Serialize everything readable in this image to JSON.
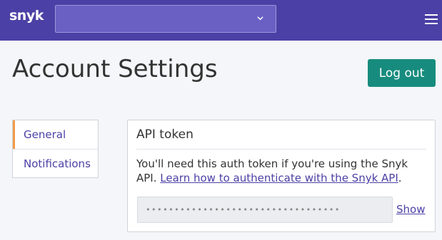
{
  "header": {
    "logo_text": "snyk",
    "org_select_value": "",
    "menu_icon": "hamburger-icon",
    "brand_color": "#4b40a5"
  },
  "page": {
    "title": "Account Settings",
    "logout_label": "Log out"
  },
  "sidebar": {
    "items": [
      {
        "label": "General",
        "active": true
      },
      {
        "label": "Notifications",
        "active": false
      }
    ]
  },
  "api_token": {
    "title": "API token",
    "description_prefix": "You'll need this auth token if you're using the Snyk API. ",
    "description_link": "Learn how to authenticate with the Snyk API",
    "description_suffix": ".",
    "masked_value": "••••••••••••••••••••••••••••••••••",
    "show_label": "Show"
  }
}
